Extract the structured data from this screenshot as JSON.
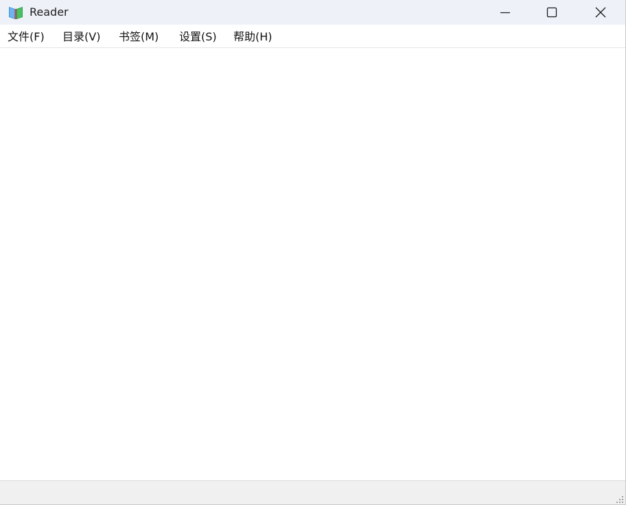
{
  "window": {
    "title": "Reader",
    "icon": "book-icon"
  },
  "menubar": {
    "items": [
      {
        "label": "文件(F)"
      },
      {
        "label": "目录(V)"
      },
      {
        "label": "书签(M)"
      },
      {
        "label": "设置(S)"
      },
      {
        "label": "帮助(H)"
      }
    ]
  },
  "controls": {
    "minimize_icon": "minimize-icon",
    "maximize_icon": "maximize-icon",
    "close_icon": "close-icon"
  },
  "statusbar": {
    "text": ""
  },
  "colors": {
    "titlebar_bg": "#eef2f8",
    "statusbar_bg": "#f0f0f0",
    "icon_blue": "#3a8fd8",
    "icon_green": "#2fa04a",
    "icon_red": "#d24a3a"
  }
}
